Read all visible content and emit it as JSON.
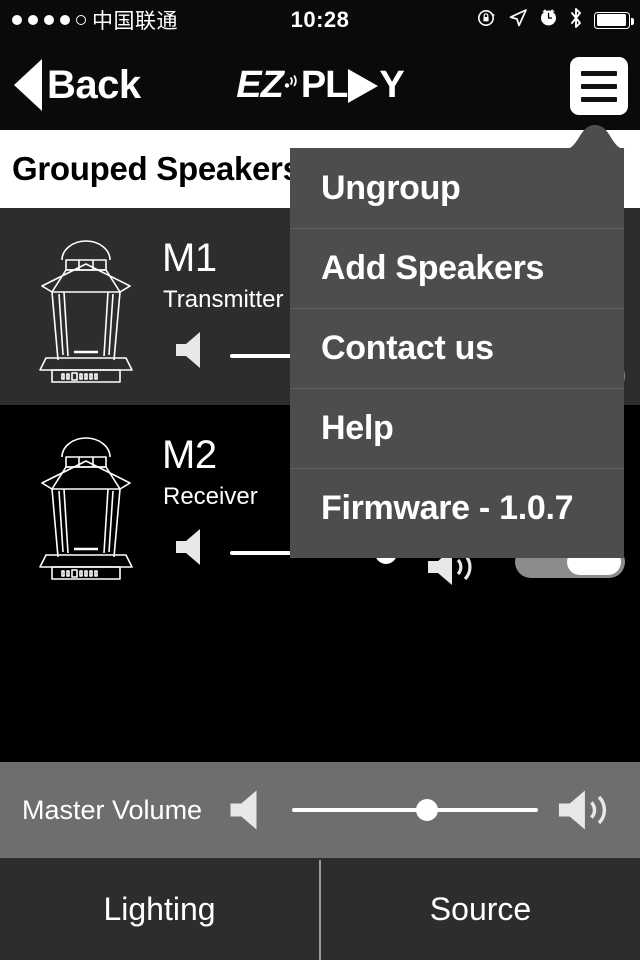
{
  "statusbar": {
    "signal_filled": 4,
    "signal_total": 5,
    "carrier": "中国联通",
    "time": "10:28",
    "icons": [
      "rotation-lock-icon",
      "location-arrow-icon",
      "alarm-clock-icon",
      "bluetooth-icon",
      "battery-icon"
    ],
    "battery_percent": 88
  },
  "header": {
    "back_label": "Back",
    "logo_ez": "EZ",
    "logo_pl": "PL",
    "logo_y": "Y",
    "logo_full": "EZ-PLAY",
    "menu_icon": "hamburger-icon"
  },
  "page": {
    "title": "Grouped Speakers"
  },
  "speakers": [
    {
      "name": "M1",
      "role": "Transmitter",
      "icon": "lantern-speaker-icon",
      "volume_percent": 62,
      "mute_icon": "speaker-low-icon",
      "max_icon": "speaker-high-icon",
      "power_on": true
    },
    {
      "name": "M2",
      "role": "Receiver",
      "icon": "lantern-speaker-icon",
      "volume_percent": 46,
      "mute_icon": "speaker-low-icon",
      "max_icon": "speaker-high-icon",
      "power_on": true
    }
  ],
  "master": {
    "label": "Master Volume",
    "volume_percent": 55,
    "low_icon": "speaker-low-icon",
    "high_icon": "speaker-high-icon"
  },
  "menu": {
    "items": [
      {
        "label": "Ungroup"
      },
      {
        "label": "Add Speakers"
      },
      {
        "label": "Contact us"
      },
      {
        "label": "Help"
      },
      {
        "label": "Firmware - 1.0.7"
      }
    ]
  },
  "tabs": [
    {
      "label": "Lighting"
    },
    {
      "label": "Source"
    }
  ],
  "colors": {
    "background": "#000000",
    "header": "#0a0a0a",
    "row_alt": "#2d2d2d",
    "menu_bg": "#4d4d4d",
    "master_bg": "#6e6e6e",
    "tabbar_bg": "#2d2d2d",
    "accent": "#ffffff"
  }
}
